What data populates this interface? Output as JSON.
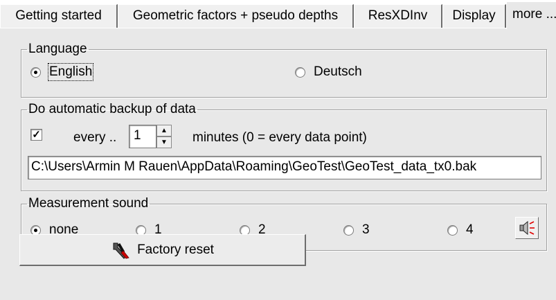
{
  "tabs": [
    {
      "label": "Getting started"
    },
    {
      "label": "Geometric factors + pseudo depths"
    },
    {
      "label": "ResXDInv"
    },
    {
      "label": "Display"
    },
    {
      "label": "more ..."
    }
  ],
  "language": {
    "legend": "Language",
    "options": [
      {
        "label": "English",
        "selected": true
      },
      {
        "label": "Deutsch",
        "selected": false
      }
    ]
  },
  "backup": {
    "legend": "Do automatic backup of data",
    "checked": true,
    "every_label": "every ..",
    "interval_value": "1",
    "minutes_label": "minutes (0 = every data point)",
    "path": "C:\\Users\\Armin M Rauen\\AppData\\Roaming\\GeoTest\\GeoTest_data_tx0.bak"
  },
  "sound": {
    "legend": "Measurement sound",
    "options": [
      {
        "label": "none",
        "selected": true
      },
      {
        "label": "1",
        "selected": false
      },
      {
        "label": "2",
        "selected": false
      },
      {
        "label": "3",
        "selected": false
      },
      {
        "label": "4",
        "selected": false
      }
    ],
    "button_icon": "speaker-icon"
  },
  "factory_reset": {
    "label": "Factory reset",
    "icon": "tools-reset-icon"
  }
}
